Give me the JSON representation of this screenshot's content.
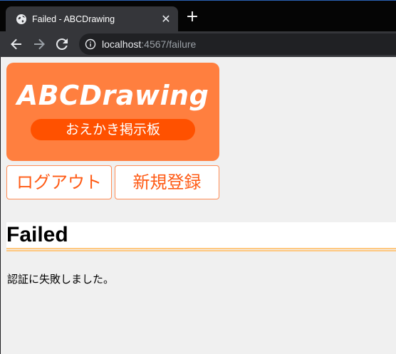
{
  "browser": {
    "tab_title": "Failed - ABCDrawing",
    "close_glyph": "✕",
    "new_tab_glyph": "+",
    "url_host": "localhost",
    "url_rest": ":4567/failure",
    "icons": [
      "globe-icon",
      "close-icon",
      "plus-icon",
      "back-icon",
      "forward-icon",
      "reload-icon",
      "info-icon"
    ]
  },
  "page": {
    "logo_title": "ABCDrawing",
    "logo_subtitle": "おえかき掲示板",
    "logout_label": "ログアウト",
    "register_label": "新規登録",
    "heading": "Failed",
    "message": "認証に失敗しました。"
  },
  "colors": {
    "logo_bg": "#ff7f3f",
    "logo_pill": "#ff5100",
    "button_text": "#ff5a14",
    "button_border": "#ff8c55",
    "heading_rule": "#ffc880",
    "page_bg": "#f0f0f0"
  }
}
